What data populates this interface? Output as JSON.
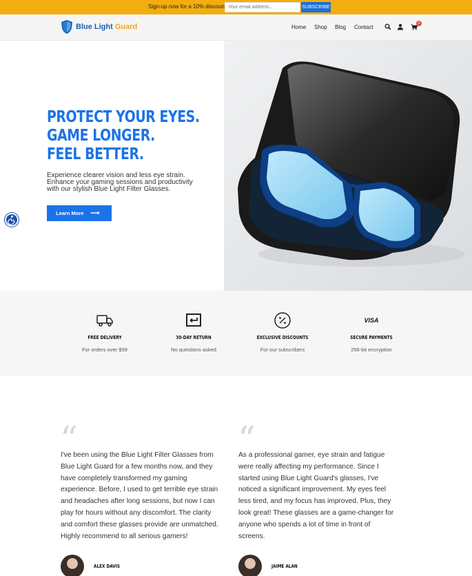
{
  "promo": {
    "text": "Sign-up now for a 10% discount!",
    "email_placeholder": "Your email address..",
    "subscribe_label": "SUBSCRIBE"
  },
  "header": {
    "logo_part1": "Blue Light",
    "logo_part2": "Guard",
    "nav": [
      "Home",
      "Shop",
      "Blog",
      "Contact"
    ],
    "cart_count": "0",
    "icons": [
      "search-icon",
      "user-icon",
      "cart-icon"
    ]
  },
  "hero": {
    "title_lines": [
      "PROTECT YOUR EYES.",
      "GAME LONGER.",
      "FEEL BETTER."
    ],
    "subtitle_lines": [
      "Experience clearer vision and less eye strain.",
      "Enhance your gaming sessions and productivity",
      "with our stylish Blue Light Filter Glasses."
    ],
    "cta_label": "Learn More",
    "image": "blue-light-glasses-in-case"
  },
  "features": [
    {
      "icon": "truck-icon",
      "title": "FREE DELIVERY",
      "subtitle": "For orders over $99"
    },
    {
      "icon": "return-icon",
      "title": "30-DAY RETURN",
      "subtitle": "No questions asked"
    },
    {
      "icon": "discount-icon",
      "title": "EXCLUSIVE DISCOUNTS",
      "subtitle": "For our subscribers"
    },
    {
      "icon": "visa-icon",
      "icon_text": "VISA",
      "title": "SECURE PAYMENTS",
      "subtitle": "256-bit encryption"
    }
  ],
  "testimonials": [
    {
      "lines": [
        "I've been using the Blue Light Filter Glasses from",
        "Blue Light Guard for a few months now, and they",
        "have completely transformed my gaming",
        "experience. Before, I used to get terrible eye strain",
        "and headaches after long sessions, but now I can",
        "play for hours without any discomfort. The clarity",
        "and comfort these glasses provide are unmatched.",
        "Highly recommend to all serious gamers!"
      ],
      "author": "ALEX DAVIS"
    },
    {
      "lines": [
        "As a professional gamer, eye strain and fatigue",
        "were really affecting my performance. Since I",
        "started using Blue Light Guard's glasses, I've",
        "noticed a significant improvement. My eyes feel",
        "less tired, and my focus has improved. Plus, they",
        "look great! These glasses are a game-changer for",
        "anyone who spends a lot of time in front of",
        "screens."
      ],
      "author": "JAIME ALAN"
    }
  ],
  "colors": {
    "promo_bar": "#f2ad0f",
    "accent_blue": "#1b73e8",
    "badge_red": "#e74c3c"
  }
}
